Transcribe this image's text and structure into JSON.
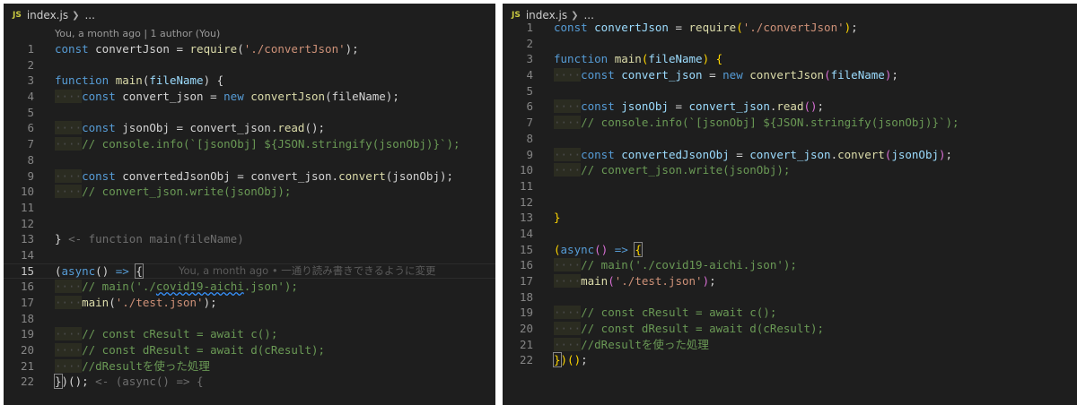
{
  "left": {
    "file_icon": "JS",
    "filename": "index.js",
    "crumb_more": "...",
    "codelens": "You, a month ago | 1 author (You)",
    "ghost_13": "<- function main(fileName)",
    "ghost_22": "<- (async() => {",
    "blame_15": "You, a month ago • 一通り読み書きできるように変更",
    "lines": [
      {
        "n": "1",
        "segs": [
          [
            "kw",
            "const "
          ],
          [
            "pl",
            "convertJson = "
          ],
          [
            "fn",
            "require"
          ],
          [
            "pl",
            "("
          ],
          [
            "str",
            "'./convertJson'"
          ],
          [
            "pl",
            ");"
          ]
        ]
      },
      {
        "n": "2",
        "segs": []
      },
      {
        "n": "3",
        "segs": [
          [
            "kw",
            "function "
          ],
          [
            "fn",
            "main"
          ],
          [
            "pl",
            "("
          ],
          [
            "var",
            "fileName"
          ],
          [
            "pl",
            ") {"
          ]
        ]
      },
      {
        "n": "4",
        "segs": [
          [
            "ind",
            "····"
          ],
          [
            "kw",
            "const "
          ],
          [
            "pl",
            "convert_json = "
          ],
          [
            "kw",
            "new "
          ],
          [
            "fn",
            "convertJson"
          ],
          [
            "pl",
            "(fileName);"
          ]
        ]
      },
      {
        "n": "5",
        "segs": []
      },
      {
        "n": "6",
        "segs": [
          [
            "ind",
            "····"
          ],
          [
            "kw",
            "const "
          ],
          [
            "pl",
            "jsonObj = convert_json."
          ],
          [
            "fn",
            "read"
          ],
          [
            "pl",
            "();"
          ]
        ]
      },
      {
        "n": "7",
        "segs": [
          [
            "ind",
            "····"
          ],
          [
            "cm",
            "// console.info(`[jsonObj] ${JSON.stringify(jsonObj)}`);"
          ]
        ]
      },
      {
        "n": "8",
        "segs": []
      },
      {
        "n": "9",
        "segs": [
          [
            "ind",
            "····"
          ],
          [
            "kw",
            "const "
          ],
          [
            "pl",
            "convertedJsonObj = convert_json."
          ],
          [
            "fn",
            "convert"
          ],
          [
            "pl",
            "(jsonObj);"
          ]
        ]
      },
      {
        "n": "10",
        "segs": [
          [
            "ind",
            "····"
          ],
          [
            "cm",
            "// convert_json.write(jsonObj);"
          ]
        ]
      },
      {
        "n": "11",
        "segs": []
      },
      {
        "n": "12",
        "segs": []
      },
      {
        "n": "13",
        "segs": [
          [
            "pl",
            "} "
          ]
        ]
      },
      {
        "n": "14",
        "segs": []
      },
      {
        "n": "15",
        "segs": [
          [
            "pl",
            "("
          ],
          [
            "kw",
            "async"
          ],
          [
            "pl",
            "() "
          ],
          [
            "kw",
            "=> "
          ],
          [
            "bm",
            "{"
          ]
        ]
      },
      {
        "n": "16",
        "segs": [
          [
            "ind",
            "····"
          ],
          [
            "cm",
            "// main('./"
          ],
          [
            "sq",
            "covid19-aichi"
          ],
          [
            "cm",
            ".json');"
          ]
        ]
      },
      {
        "n": "17",
        "segs": [
          [
            "ind",
            "····"
          ],
          [
            "fn",
            "main"
          ],
          [
            "pl",
            "("
          ],
          [
            "str",
            "'./test.json'"
          ],
          [
            "pl",
            ");"
          ]
        ]
      },
      {
        "n": "18",
        "segs": []
      },
      {
        "n": "19",
        "segs": [
          [
            "ind",
            "····"
          ],
          [
            "cm",
            "// const cResult = await c();"
          ]
        ]
      },
      {
        "n": "20",
        "segs": [
          [
            "ind",
            "····"
          ],
          [
            "cm",
            "// const dResult = await d(cResult);"
          ]
        ]
      },
      {
        "n": "21",
        "segs": [
          [
            "ind",
            "····"
          ],
          [
            "cm",
            "//dResultを使った処理"
          ]
        ]
      },
      {
        "n": "22",
        "segs": [
          [
            "bm",
            "}"
          ],
          [
            "pl",
            ")(); "
          ]
        ]
      }
    ]
  },
  "right": {
    "file_icon": "JS",
    "filename": "index.js",
    "crumb_more": "...",
    "lines": [
      {
        "n": "1",
        "segs": [
          [
            "kw",
            "const "
          ],
          [
            "var",
            "convertJson"
          ],
          [
            "pl",
            " = "
          ],
          [
            "fn",
            "require"
          ],
          [
            "y",
            "("
          ],
          [
            "str",
            "'./convertJson'"
          ],
          [
            "y",
            ")"
          ],
          [
            "pl",
            ";"
          ]
        ]
      },
      {
        "n": "2",
        "segs": []
      },
      {
        "n": "3",
        "segs": [
          [
            "kw",
            "function "
          ],
          [
            "fn",
            "main"
          ],
          [
            "y",
            "("
          ],
          [
            "var",
            "fileName"
          ],
          [
            "y",
            ")"
          ],
          [
            "pl",
            " "
          ],
          [
            "y",
            "{"
          ]
        ]
      },
      {
        "n": "4",
        "segs": [
          [
            "ind",
            "····"
          ],
          [
            "kw",
            "const "
          ],
          [
            "var",
            "convert_json"
          ],
          [
            "pl",
            " = "
          ],
          [
            "kw",
            "new "
          ],
          [
            "fn",
            "convertJson"
          ],
          [
            "p",
            "("
          ],
          [
            "var",
            "fileName"
          ],
          [
            "p",
            ")"
          ],
          [
            "pl",
            ";"
          ]
        ]
      },
      {
        "n": "5",
        "segs": []
      },
      {
        "n": "6",
        "segs": [
          [
            "ind",
            "····"
          ],
          [
            "kw",
            "const "
          ],
          [
            "var",
            "jsonObj"
          ],
          [
            "pl",
            " = "
          ],
          [
            "var",
            "convert_json"
          ],
          [
            "pl",
            "."
          ],
          [
            "fn",
            "read"
          ],
          [
            "p",
            "()"
          ],
          [
            "pl",
            ";"
          ]
        ]
      },
      {
        "n": "7",
        "segs": [
          [
            "ind",
            "····"
          ],
          [
            "cm",
            "// console.info(`[jsonObj] ${JSON.stringify(jsonObj)}`);"
          ]
        ]
      },
      {
        "n": "8",
        "segs": []
      },
      {
        "n": "9",
        "segs": [
          [
            "ind",
            "····"
          ],
          [
            "kw",
            "const "
          ],
          [
            "var",
            "convertedJsonObj"
          ],
          [
            "pl",
            " = "
          ],
          [
            "var",
            "convert_json"
          ],
          [
            "pl",
            "."
          ],
          [
            "fn",
            "convert"
          ],
          [
            "p",
            "("
          ],
          [
            "var",
            "jsonObj"
          ],
          [
            "p",
            ")"
          ],
          [
            "pl",
            ";"
          ]
        ]
      },
      {
        "n": "10",
        "segs": [
          [
            "ind",
            "····"
          ],
          [
            "cm",
            "// convert_json.write(jsonObj);"
          ]
        ]
      },
      {
        "n": "11",
        "segs": []
      },
      {
        "n": "12",
        "segs": []
      },
      {
        "n": "13",
        "segs": [
          [
            "y",
            "}"
          ]
        ]
      },
      {
        "n": "14",
        "segs": []
      },
      {
        "n": "15",
        "segs": [
          [
            "y",
            "("
          ],
          [
            "kw",
            "async"
          ],
          [
            "p",
            "()"
          ],
          [
            "pl",
            " "
          ],
          [
            "kw",
            "=>"
          ],
          [
            "pl",
            " "
          ],
          [
            "bm",
            "{"
          ]
        ]
      },
      {
        "n": "16",
        "segs": [
          [
            "ind",
            "····"
          ],
          [
            "cm",
            "// main('./covid19-aichi.json');"
          ]
        ]
      },
      {
        "n": "17",
        "segs": [
          [
            "ind",
            "····"
          ],
          [
            "fn",
            "main"
          ],
          [
            "p",
            "("
          ],
          [
            "str",
            "'./test.json'"
          ],
          [
            "p",
            ")"
          ],
          [
            "pl",
            ";"
          ]
        ]
      },
      {
        "n": "18",
        "segs": []
      },
      {
        "n": "19",
        "segs": [
          [
            "ind",
            "····"
          ],
          [
            "cm",
            "// const cResult = await c();"
          ]
        ]
      },
      {
        "n": "20",
        "segs": [
          [
            "ind",
            "····"
          ],
          [
            "cm",
            "// const dResult = await d(cResult);"
          ]
        ]
      },
      {
        "n": "21",
        "segs": [
          [
            "ind",
            "····"
          ],
          [
            "cm",
            "//dResultを使った処理"
          ]
        ]
      },
      {
        "n": "22",
        "segs": [
          [
            "bm",
            "}"
          ],
          [
            "y",
            ")()"
          ],
          [
            "pl",
            ";"
          ]
        ]
      }
    ]
  }
}
